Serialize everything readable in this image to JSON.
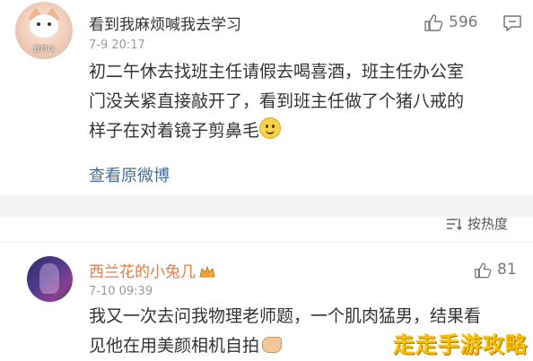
{
  "comment1": {
    "username": "看到我麻烦喊我去学习",
    "avatar_caption": "我可以",
    "time": "7-9 20:17",
    "likes": "596",
    "text_lines": [
      "初二午休去找班主任请假去喝喜酒，班主任办公室",
      "门没关紧直接敲开了，看到班主任做了个猪八戒的",
      "样子在对着镜子剪鼻毛"
    ],
    "view_original": "查看原微博"
  },
  "sort": {
    "label": "按热度"
  },
  "comment2": {
    "username": "西兰花的小兔几",
    "time": "7-10 09:39",
    "likes": "81",
    "text_lines": [
      "我又一次去问我物理老师题，一个肌肉猛男，结果看",
      "见他在用美颜相机自拍"
    ]
  },
  "watermark": "走走手游攻略",
  "colors": {
    "username_highlight": "#e57a44",
    "link": "#4a6c98",
    "watermark": "#f6c000"
  }
}
